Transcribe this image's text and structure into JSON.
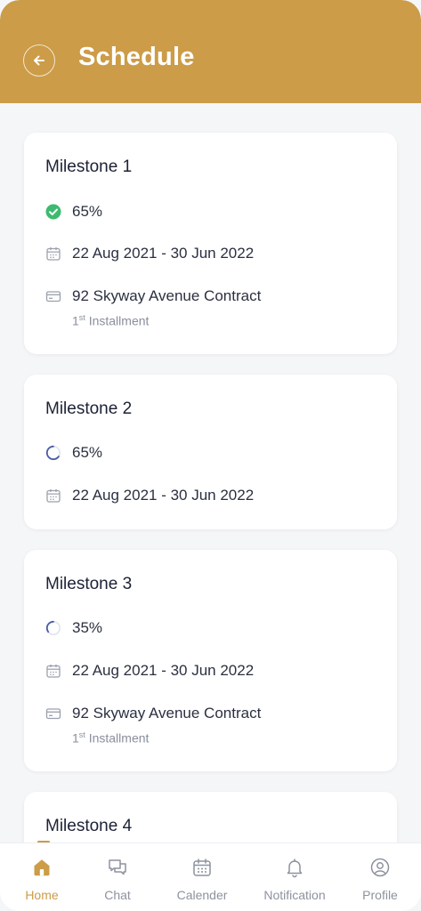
{
  "header": {
    "title": "Schedule"
  },
  "milestones": [
    {
      "title": "Milestone 1",
      "status": "complete",
      "progress": "65%",
      "progress_fraction": 0.65,
      "dates": "22 Aug 2021 - 30 Jun 2022",
      "contract": "92 Skyway Avenue Contract",
      "installment_num": "1",
      "installment_sup": "st",
      "installment_label": "Installment"
    },
    {
      "title": "Milestone 2",
      "status": "in-progress",
      "progress": "65%",
      "progress_fraction": 0.65,
      "dates": "22 Aug 2021 - 30 Jun 2022"
    },
    {
      "title": "Milestone 3",
      "status": "in-progress",
      "progress": "35%",
      "progress_fraction": 0.35,
      "dates": "22 Aug 2021 - 30 Jun 2022",
      "contract": "92 Skyway Avenue Contract",
      "installment_num": "1",
      "installment_sup": "st",
      "installment_label": "Installment"
    },
    {
      "title": "Milestone 4"
    }
  ],
  "nav": {
    "items": [
      {
        "label": "Home",
        "icon": "home-icon",
        "active": true
      },
      {
        "label": "Chat",
        "icon": "chat-icon",
        "active": false
      },
      {
        "label": "Calender",
        "icon": "calendar-icon",
        "active": false
      },
      {
        "label": "Notification",
        "icon": "bell-icon",
        "active": false
      },
      {
        "label": "Profile",
        "icon": "profile-icon",
        "active": false
      }
    ]
  },
  "colors": {
    "accent": "#cc9c48",
    "success": "#3dba6f",
    "progress": "#4a5ca8",
    "background": "#f5f6f8"
  }
}
